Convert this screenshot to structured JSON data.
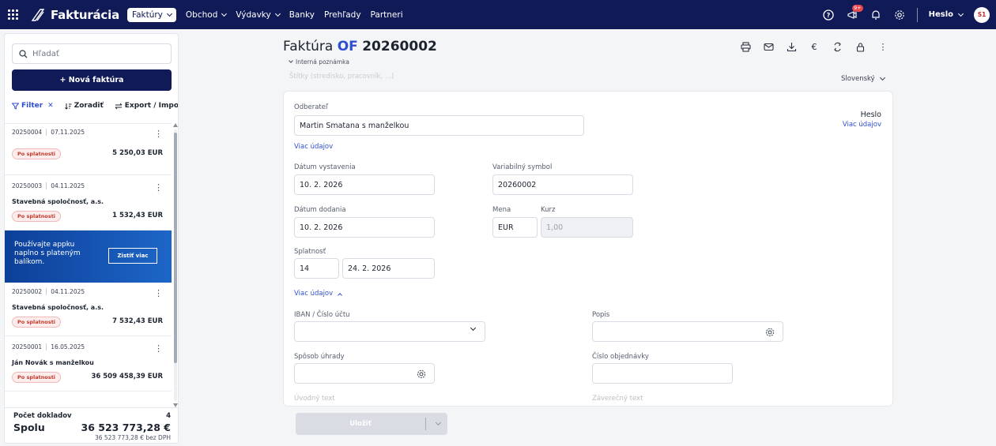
{
  "topbar": {
    "brand": "Fakturácia",
    "nav": [
      {
        "label": "Faktúry",
        "active": true,
        "dropdown": true
      },
      {
        "label": "Obchod",
        "dropdown": true
      },
      {
        "label": "Výdavky",
        "dropdown": true
      },
      {
        "label": "Banky"
      },
      {
        "label": "Prehľady"
      },
      {
        "label": "Partneri"
      }
    ],
    "notif_badge": "9+",
    "user": "Heslo",
    "avatar": "S1",
    "colors": {
      "nav_bg": "#101a56",
      "accent": "#2f4fd1",
      "danger": "#c0392b"
    }
  },
  "sidebar": {
    "search_placeholder": "Hľadať",
    "new_invoice": "+ Nová faktúra",
    "filter": "Filter",
    "sort": "Zoradiť",
    "export": "Export / Import",
    "invoices": [
      {
        "number": "20250004",
        "date": "07.11.2025",
        "client": "",
        "status": "Po splatnosti",
        "amount": "5 250,03 EUR"
      },
      {
        "number": "20250003",
        "date": "04.11.2025",
        "client": "Stavebná spoločnosť, a.s.",
        "status": "Po splatnosti",
        "amount": "1 532,43 EUR"
      },
      {
        "number": "20250002",
        "date": "04.11.2025",
        "client": "Stavebná spoločnosť, a.s.",
        "status": "Po splatnosti",
        "amount": "7 532,43 EUR"
      },
      {
        "number": "20250001",
        "date": "16.05.2025",
        "client": "Ján Novák s manželkou",
        "status": "Po splatnosti",
        "amount": "36 509 458,39 EUR"
      }
    ],
    "promo": {
      "text": "Používajte appku naplno s plateným balíkom.",
      "button": "Zistiť viac"
    },
    "summary": {
      "count_label": "Počet dokladov",
      "count": "4",
      "total_label": "Spolu",
      "total": "36 523 773,28 €",
      "net": "36 523 773,28 € bez DPH"
    }
  },
  "main": {
    "title_prefix": "Faktúra",
    "title_series": "OF",
    "title_number": "20260002",
    "internal_note": "Interná poznámka",
    "tags_placeholder": "Štítky (stredisko, pracovník, ...)",
    "language": "Slovenský",
    "form": {
      "customer_label": "Odberateľ",
      "customer_value": "Martin Smatana s manželkou",
      "more_details": "Viac údajov",
      "heslo": "Heslo",
      "heslo_more": "Viac údajov",
      "issue_date_label": "Dátum vystavenia",
      "issue_date": "10. 2. 2026",
      "variable_symbol_label": "Variabilný symbol",
      "variable_symbol": "20260002",
      "delivery_date_label": "Dátum dodania",
      "delivery_date": "10. 2. 2026",
      "currency_label": "Mena",
      "currency": "EUR",
      "rate_label": "Kurz",
      "rate": "1,00",
      "due_label": "Splatnosť",
      "due_days": "14",
      "due_date": "24. 2. 2026",
      "more_details_open": "Viac údajov",
      "iban_label": "IBAN / Číslo účtu",
      "description_label": "Popis",
      "payment_method_label": "Spôsob úhrady",
      "order_number_label": "Číslo objednávky",
      "intro_text_label": "Úvodný text",
      "closing_text_label": "Záverečný text"
    },
    "save": "Uložiť"
  }
}
